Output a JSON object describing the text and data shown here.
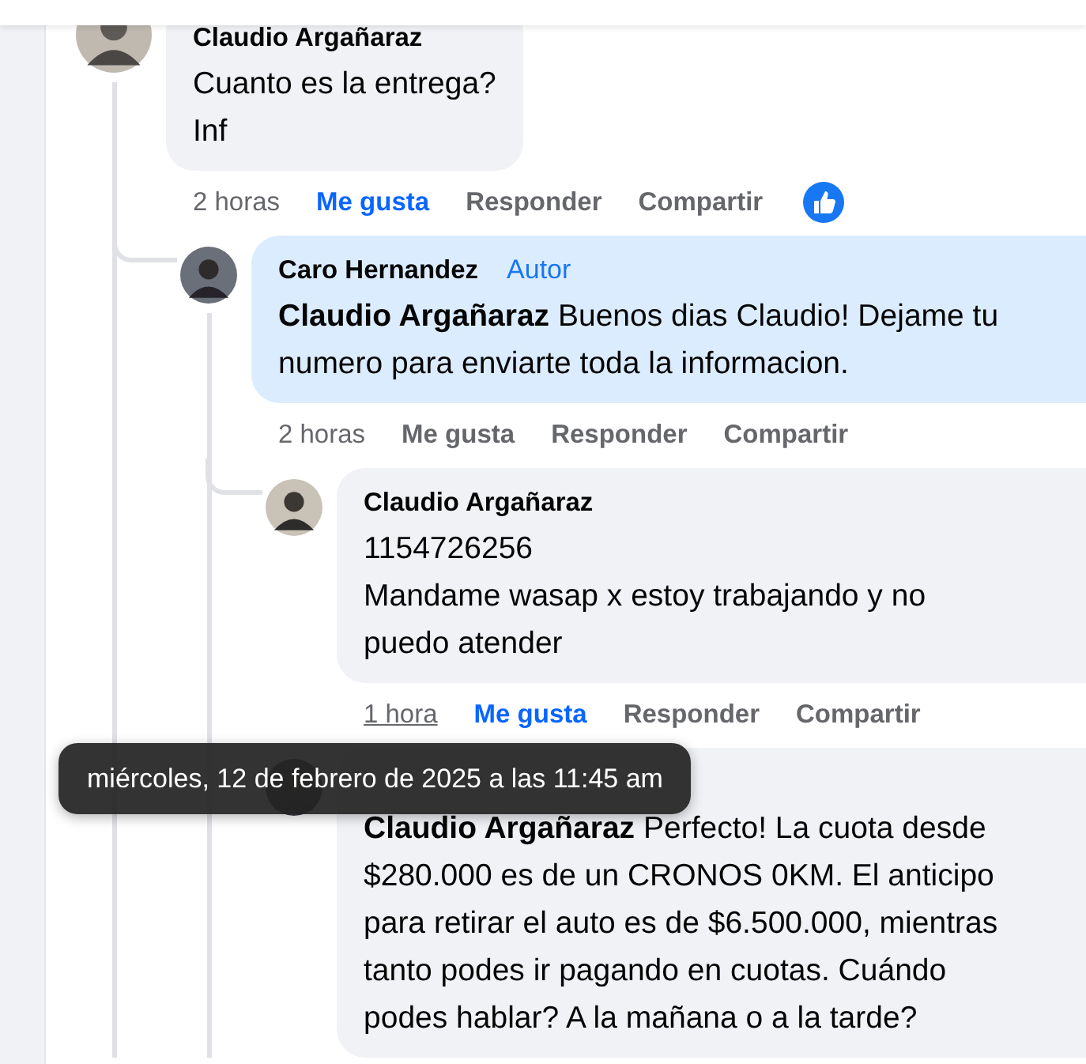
{
  "comments": [
    {
      "author": "Claudio Argañaraz",
      "text": "Cuanto es la entrega?\nInf",
      "highlighted": false,
      "reacted": true,
      "actions": [
        {
          "kind": "time",
          "label": "2 horas",
          "hovered": false
        },
        {
          "kind": "like",
          "label": "Me gusta",
          "selected": true
        },
        {
          "kind": "reply",
          "label": "Responder"
        },
        {
          "kind": "share",
          "label": "Compartir"
        }
      ],
      "children": [
        {
          "author": "Caro Hernandez",
          "author_badge": "Autor",
          "text": "**Claudio Argañaraz** Buenos dias Claudio! Dejame tu\nnumero para enviarte toda la informacion.",
          "highlighted": true,
          "actions": [
            {
              "kind": "time",
              "label": "2 horas",
              "hovered": false
            },
            {
              "kind": "like",
              "label": "Me gusta",
              "selected": false
            },
            {
              "kind": "reply",
              "label": "Responder"
            },
            {
              "kind": "share",
              "label": "Compartir"
            }
          ],
          "children": [
            {
              "author": "Claudio Argañaraz",
              "text": "1154726256\nMandame wasap x estoy trabajando y no\npuedo atender",
              "highlighted": false,
              "actions": [
                {
                  "kind": "time",
                  "label": "1 hora",
                  "hovered": true
                },
                {
                  "kind": "like",
                  "label": "Me gusta",
                  "selected": true
                },
                {
                  "kind": "reply",
                  "label": "Responder"
                },
                {
                  "kind": "share",
                  "label": "Compartir"
                }
              ]
            },
            {
              "text": "**Claudio Argañaraz** Perfecto! La cuota desde\n$280.000 es de un CRONOS 0KM. El anticipo\npara retirar el auto es de $6.500.000, mientras\ntanto podes ir pagando en cuotas. Cuándo\npodes hablar? A la mañana o a la tarde?",
              "highlighted": false
            }
          ]
        }
      ]
    }
  ],
  "tooltip": {
    "text": "miércoles, 12 de febrero de 2025 a las 11:45 am"
  }
}
